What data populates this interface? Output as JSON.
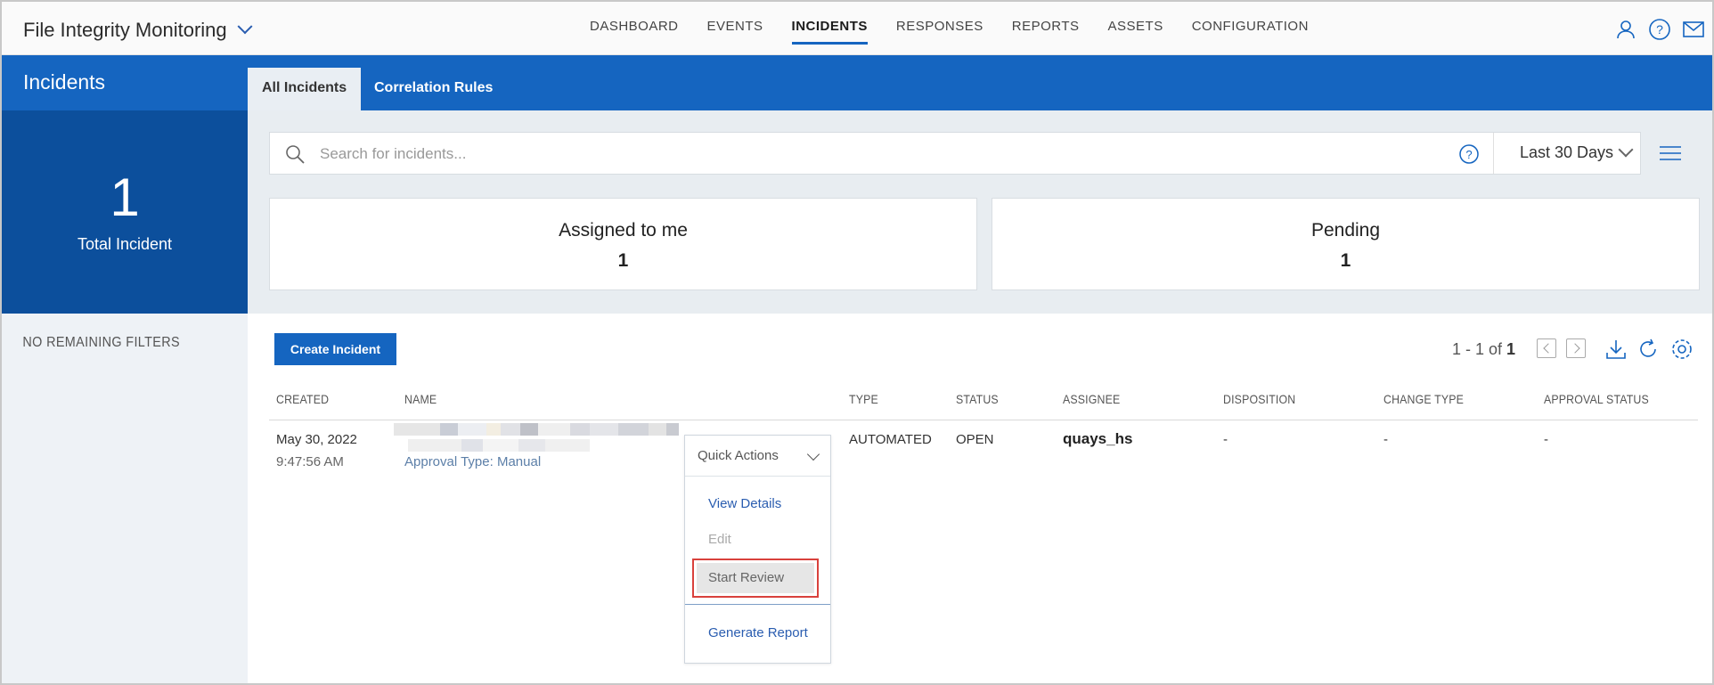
{
  "app": {
    "title": "File Integrity Monitoring"
  },
  "nav": {
    "items": [
      "DASHBOARD",
      "EVENTS",
      "INCIDENTS",
      "RESPONSES",
      "REPORTS",
      "ASSETS",
      "CONFIGURATION"
    ],
    "active": "INCIDENTS"
  },
  "top_icons": [
    "user-icon",
    "help-icon",
    "mail-icon"
  ],
  "sidebar": {
    "title": "Incidents",
    "count": "1",
    "count_label": "Total Incident",
    "filters_text": "NO REMAINING FILTERS"
  },
  "tabs": [
    {
      "label": "All Incidents",
      "active": true
    },
    {
      "label": "Correlation Rules",
      "active": false
    }
  ],
  "search": {
    "placeholder": "Search for incidents...",
    "value": "",
    "range": "Last 30 Days"
  },
  "cards": [
    {
      "title": "Assigned to me",
      "value": "1"
    },
    {
      "title": "Pending",
      "value": "1"
    }
  ],
  "toolbar": {
    "create_label": "Create Incident"
  },
  "pager": {
    "range": "1 - 1 of",
    "total": "1"
  },
  "table": {
    "headers": [
      "CREATED",
      "NAME",
      "TYPE",
      "STATUS",
      "ASSIGNEE",
      "DISPOSITION",
      "CHANGE TYPE",
      "APPROVAL STATUS"
    ],
    "rows": [
      {
        "created_date": "May 30, 2022",
        "created_time": "9:47:56 AM",
        "name_sub": "Approval Type: Manual",
        "type": "AUTOMATED",
        "status": "OPEN",
        "assignee": "quays_hs",
        "disposition": "-",
        "change_type": "-",
        "approval_status": "-"
      }
    ]
  },
  "quick_actions": {
    "label": "Quick Actions",
    "items": [
      "View Details",
      "Edit",
      "Start Review",
      "Generate Report"
    ]
  },
  "colors": {
    "brand": "#1565c0",
    "brand_dark": "#0c4f9c",
    "highlight": "#d9413c"
  }
}
